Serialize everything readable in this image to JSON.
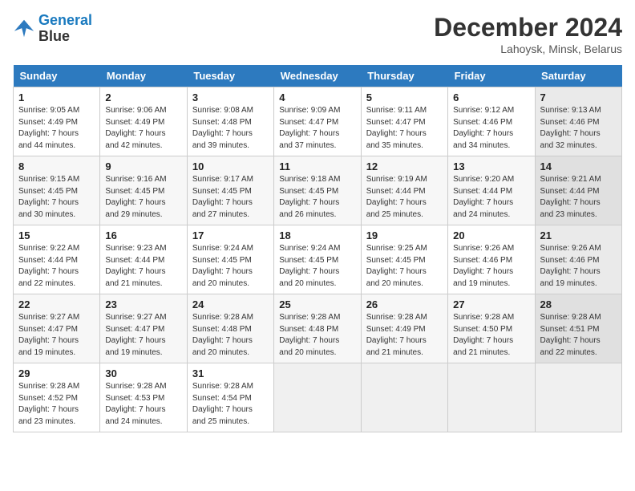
{
  "header": {
    "logo_line1": "General",
    "logo_line2": "Blue",
    "month": "December 2024",
    "location": "Lahoysk, Minsk, Belarus"
  },
  "weekdays": [
    "Sunday",
    "Monday",
    "Tuesday",
    "Wednesday",
    "Thursday",
    "Friday",
    "Saturday"
  ],
  "weeks": [
    [
      {
        "day": "1",
        "sunrise": "9:05 AM",
        "sunset": "4:49 PM",
        "daylight": "7 hours and 44 minutes."
      },
      {
        "day": "2",
        "sunrise": "9:06 AM",
        "sunset": "4:49 PM",
        "daylight": "7 hours and 42 minutes."
      },
      {
        "day": "3",
        "sunrise": "9:08 AM",
        "sunset": "4:48 PM",
        "daylight": "7 hours and 39 minutes."
      },
      {
        "day": "4",
        "sunrise": "9:09 AM",
        "sunset": "4:47 PM",
        "daylight": "7 hours and 37 minutes."
      },
      {
        "day": "5",
        "sunrise": "9:11 AM",
        "sunset": "4:47 PM",
        "daylight": "7 hours and 35 minutes."
      },
      {
        "day": "6",
        "sunrise": "9:12 AM",
        "sunset": "4:46 PM",
        "daylight": "7 hours and 34 minutes."
      },
      {
        "day": "7",
        "sunrise": "9:13 AM",
        "sunset": "4:46 PM",
        "daylight": "7 hours and 32 minutes."
      }
    ],
    [
      {
        "day": "8",
        "sunrise": "9:15 AM",
        "sunset": "4:45 PM",
        "daylight": "7 hours and 30 minutes."
      },
      {
        "day": "9",
        "sunrise": "9:16 AM",
        "sunset": "4:45 PM",
        "daylight": "7 hours and 29 minutes."
      },
      {
        "day": "10",
        "sunrise": "9:17 AM",
        "sunset": "4:45 PM",
        "daylight": "7 hours and 27 minutes."
      },
      {
        "day": "11",
        "sunrise": "9:18 AM",
        "sunset": "4:45 PM",
        "daylight": "7 hours and 26 minutes."
      },
      {
        "day": "12",
        "sunrise": "9:19 AM",
        "sunset": "4:44 PM",
        "daylight": "7 hours and 25 minutes."
      },
      {
        "day": "13",
        "sunrise": "9:20 AM",
        "sunset": "4:44 PM",
        "daylight": "7 hours and 24 minutes."
      },
      {
        "day": "14",
        "sunrise": "9:21 AM",
        "sunset": "4:44 PM",
        "daylight": "7 hours and 23 minutes."
      }
    ],
    [
      {
        "day": "15",
        "sunrise": "9:22 AM",
        "sunset": "4:44 PM",
        "daylight": "7 hours and 22 minutes."
      },
      {
        "day": "16",
        "sunrise": "9:23 AM",
        "sunset": "4:44 PM",
        "daylight": "7 hours and 21 minutes."
      },
      {
        "day": "17",
        "sunrise": "9:24 AM",
        "sunset": "4:45 PM",
        "daylight": "7 hours and 20 minutes."
      },
      {
        "day": "18",
        "sunrise": "9:24 AM",
        "sunset": "4:45 PM",
        "daylight": "7 hours and 20 minutes."
      },
      {
        "day": "19",
        "sunrise": "9:25 AM",
        "sunset": "4:45 PM",
        "daylight": "7 hours and 20 minutes."
      },
      {
        "day": "20",
        "sunrise": "9:26 AM",
        "sunset": "4:46 PM",
        "daylight": "7 hours and 19 minutes."
      },
      {
        "day": "21",
        "sunrise": "9:26 AM",
        "sunset": "4:46 PM",
        "daylight": "7 hours and 19 minutes."
      }
    ],
    [
      {
        "day": "22",
        "sunrise": "9:27 AM",
        "sunset": "4:47 PM",
        "daylight": "7 hours and 19 minutes."
      },
      {
        "day": "23",
        "sunrise": "9:27 AM",
        "sunset": "4:47 PM",
        "daylight": "7 hours and 19 minutes."
      },
      {
        "day": "24",
        "sunrise": "9:28 AM",
        "sunset": "4:48 PM",
        "daylight": "7 hours and 20 minutes."
      },
      {
        "day": "25",
        "sunrise": "9:28 AM",
        "sunset": "4:48 PM",
        "daylight": "7 hours and 20 minutes."
      },
      {
        "day": "26",
        "sunrise": "9:28 AM",
        "sunset": "4:49 PM",
        "daylight": "7 hours and 21 minutes."
      },
      {
        "day": "27",
        "sunrise": "9:28 AM",
        "sunset": "4:50 PM",
        "daylight": "7 hours and 21 minutes."
      },
      {
        "day": "28",
        "sunrise": "9:28 AM",
        "sunset": "4:51 PM",
        "daylight": "7 hours and 22 minutes."
      }
    ],
    [
      {
        "day": "29",
        "sunrise": "9:28 AM",
        "sunset": "4:52 PM",
        "daylight": "7 hours and 23 minutes."
      },
      {
        "day": "30",
        "sunrise": "9:28 AM",
        "sunset": "4:53 PM",
        "daylight": "7 hours and 24 minutes."
      },
      {
        "day": "31",
        "sunrise": "9:28 AM",
        "sunset": "4:54 PM",
        "daylight": "7 hours and 25 minutes."
      },
      null,
      null,
      null,
      null
    ]
  ]
}
